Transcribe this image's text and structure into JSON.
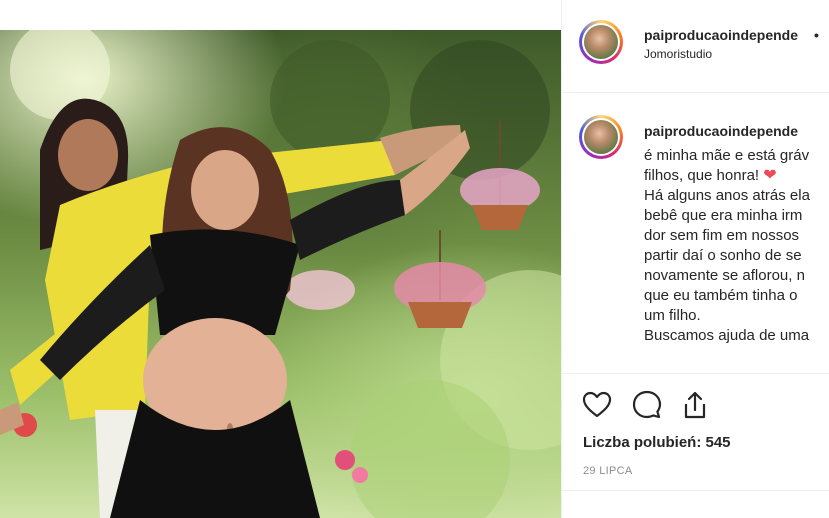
{
  "post": {
    "username": "paiproducaoindepende",
    "header_separator": "•",
    "location": "Jomoristudio",
    "caption_lines": [
      "é minha mãe e está gráv",
      "filhos, que honra!",
      "Há alguns anos atrás ela",
      "bebê que era minha irm",
      "dor sem fim em nossos",
      "partir daí o sonho de se",
      "novamente se aflorou, n",
      "que eu também tinha o",
      "um filho.",
      "Buscamos ajuda de uma"
    ],
    "caption_emoji": "❤",
    "likes_label": "Liczba polubień: 545",
    "date": "29 LIPCA"
  },
  "colors": {
    "heart": "#ed4956",
    "text": "#262626",
    "muted": "#8e8e8e",
    "divider": "#efefef"
  },
  "icons": [
    "heart-icon",
    "comment-icon",
    "share-icon"
  ]
}
